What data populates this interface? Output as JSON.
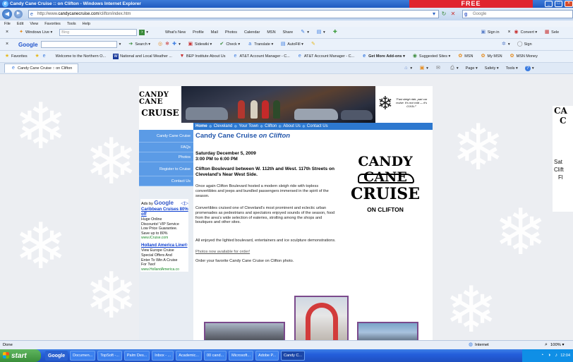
{
  "window": {
    "title": "Candy Cane Cruise :: on Clifton - Windows Internet Explorer",
    "promo": "FREE"
  },
  "address": {
    "prefix": "http://www.",
    "domain": "candycanecruise.com",
    "path": "/clifton/index.htm",
    "search_placeholder": "Google"
  },
  "menu": [
    "File",
    "Edit",
    "View",
    "Favorites",
    "Tools",
    "Help"
  ],
  "toolbar1": {
    "live_label": "Windows Live",
    "bing_placeholder": "Bing",
    "links": [
      "What's New",
      "Profile",
      "Mail",
      "Photos",
      "Calendar",
      "MSN",
      "Share"
    ],
    "sign_in": "Sign in",
    "convert": "Convert",
    "select": "Sele"
  },
  "toolbar2": {
    "google_label": "Google",
    "items": [
      "Search",
      "Sidewiki",
      "Check",
      "Translate",
      "AutoFill"
    ],
    "sign_in": "Sign"
  },
  "favorites": {
    "label": "Favorites",
    "items": [
      "Welcome to the Northern O...",
      "National and Local Weather ...",
      "BEP Institute About Us",
      "AT&T Account Manager - C...",
      "AT&T Account Manager - C...",
      "Get More Add-ons",
      "Suggested Sites",
      "MSN",
      "My MSN",
      "MSN Money"
    ]
  },
  "tab": {
    "label": "Candy Cane Cruise :: on Clifton",
    "commands": [
      "Page",
      "Safety",
      "Tools"
    ]
  },
  "site": {
    "logo_top": "CANDY CANE",
    "logo_bottom": "CRUISE",
    "sleigh_quote": "\"Fast sleigh ride, part car cruise. It's not cold — it's COOL!\"",
    "nav": [
      "Home",
      "Cleveland",
      "Your Town",
      "Clifton",
      "About Us",
      "Contact Us"
    ],
    "sidebar": [
      "Candy Cane Cruise",
      "FAQs",
      "Photos",
      "Register to Cruise",
      "Contact Us"
    ],
    "ads": {
      "header": "Ads by",
      "google": "Google",
      "ad1": {
        "title": "Caribbean Cruises 80% off",
        "lines": [
          "Huge Online",
          "Discounts! VIP Service",
          "Low Price Guarantee.",
          "Save up to 80%"
        ],
        "url": "www.iCruise.com"
      },
      "ad2": {
        "title": "Holland America Line®",
        "lines": [
          "View Europe Cruise",
          "Special Offers And",
          "Enter To Win A Cruise",
          "For Two!"
        ],
        "url": "www.HollandAmerica.co"
      }
    },
    "title_main": "Candy Cane Cruise ",
    "title_em": "on Clifton",
    "date_line1": "Saturday December 5, 2009",
    "date_line2": "3:00 PM to 6:00 PM",
    "location": "Clifton Boulevard between W. 112th and West. 117th Streets on Cleveland's Near West Side.",
    "para1": "Once again Clifton Boulevard hosted a modern sleigh ride with topless convertibles and jeeps and bundled passengers immersed in the spirit of the season.",
    "para2": "Convertibles cruised one of Cleveland's most prominent and eclectic urban promenades as pedestrians and spectators enjoyed sounds of the season, food from the area's wide selection of eateries, strolling among the shops and boutiques and other sites.",
    "para3": "All enjoyed the lighted boulevard, entertainers and ice sculpture demonstrations.",
    "photos_link": "Photos now available for order!",
    "order_line": "Order your favorite Candy Cane Cruise on Clifton photo.",
    "big_logo_top": "CANDY CANE",
    "big_logo_mid": "CRUISE",
    "big_logo_bottom": "ON CLIFTON"
  },
  "right_preview": {
    "logo": "CA",
    "logo2": "C",
    "line1": "Sat",
    "line2": "Clift",
    "line3": "Fl"
  },
  "status": {
    "left": "Done",
    "zone": "Internet",
    "zoom": "100%"
  },
  "taskbar": {
    "start": "start",
    "items": [
      "Google",
      "Documen...",
      "TopSoft -...",
      "Palm Des...",
      "Inbox - ...",
      "Academic...",
      "00 cand...",
      "Microsoft...",
      "Adobe P...",
      "Candy C..."
    ],
    "clock": "12:04"
  }
}
